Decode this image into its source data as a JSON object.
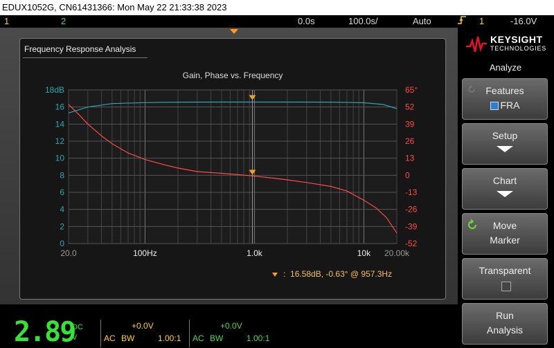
{
  "titlebar": {
    "text": "EDUX1052G, CN61431366: Mon May 22 21:33:38 2023"
  },
  "status": {
    "ch1": "1",
    "ch2": "2",
    "time_pos": "0.0s",
    "time_scale": "100.0s/",
    "trigger_mode": "Auto",
    "trigger_icon": "rising-edge",
    "trigger_ch": "1",
    "trigger_level": "-16.0V"
  },
  "panel": {
    "title": "Frequency Response Analysis",
    "chart_title": "Gain, Phase vs. Frequency",
    "readout": "16.58dB, -0.63° @ 957.3Hz"
  },
  "chart_data": {
    "type": "line",
    "title": "Gain, Phase vs. Frequency",
    "xscale": "log",
    "xlim": [
      20,
      20000
    ],
    "x_tick_labels": [
      "20.0",
      "100Hz",
      "1.0k",
      "10k",
      "20.00k"
    ],
    "x_tick_values": [
      20,
      100,
      1000,
      10000,
      20000
    ],
    "left_axis": {
      "labels": [
        "18dB",
        "16",
        "14",
        "12",
        "10",
        "8",
        "6",
        "4",
        "2",
        "0"
      ],
      "ylim": [
        0,
        18
      ],
      "color": "#2aa8b0"
    },
    "right_axis": {
      "labels": [
        "65°",
        "52",
        "39",
        "26",
        "13",
        "0",
        "-13",
        "-26",
        "-39",
        "-52"
      ],
      "ylim": [
        -52,
        65
      ],
      "color": "#ff4a4a"
    },
    "series": [
      {
        "axis": "left",
        "color": "#2aa8b0",
        "x": [
          20,
          30,
          50,
          100,
          200,
          500,
          1000,
          2000,
          5000,
          10000,
          15000,
          20000
        ],
        "y": [
          15.3,
          16.0,
          16.4,
          16.52,
          16.57,
          16.58,
          16.58,
          16.58,
          16.57,
          16.5,
          16.3,
          15.8
        ]
      },
      {
        "axis": "right",
        "color": "#ff4a4a",
        "x": [
          20,
          25,
          30,
          40,
          50,
          70,
          100,
          150,
          200,
          300,
          500,
          700,
          1000,
          1500,
          2000,
          3000,
          5000,
          7000,
          10000,
          13000,
          16000,
          20000
        ],
        "y": [
          54,
          46,
          39,
          30,
          24,
          17,
          12,
          8,
          5.5,
          2.8,
          1.5,
          0.5,
          -0.6,
          -2.2,
          -3.5,
          -5.5,
          -8.5,
          -12,
          -19,
          -25,
          -32,
          -44
        ]
      }
    ],
    "markers": [
      {
        "x": 957.3,
        "gain_db": 16.58,
        "phase_deg": -0.63
      }
    ],
    "grid": true
  },
  "bottom": {
    "big_value": "2.89",
    "coupling_top": "DC",
    "coupling_bottom": "V",
    "ch1": {
      "offset": "+0.0V",
      "coupling": "AC",
      "bw": "BW",
      "probe": "1.00:1"
    },
    "ch2": {
      "offset": "+0.0V",
      "coupling": "AC",
      "bw": "BW",
      "probe": "1.00:1"
    }
  },
  "softkeys": {
    "logo_text": "KEYSIGHT",
    "logo_sub": "TECHNOLOGIES",
    "menu_title": "Analyze",
    "features": {
      "label": "Features",
      "value": "FRA"
    },
    "setup": "Setup",
    "chart": "Chart",
    "move_marker": {
      "l1": "Move",
      "l2": "Marker"
    },
    "transparent": "Transparent",
    "run_analysis": {
      "l1": "Run",
      "l2": "Analysis"
    }
  }
}
